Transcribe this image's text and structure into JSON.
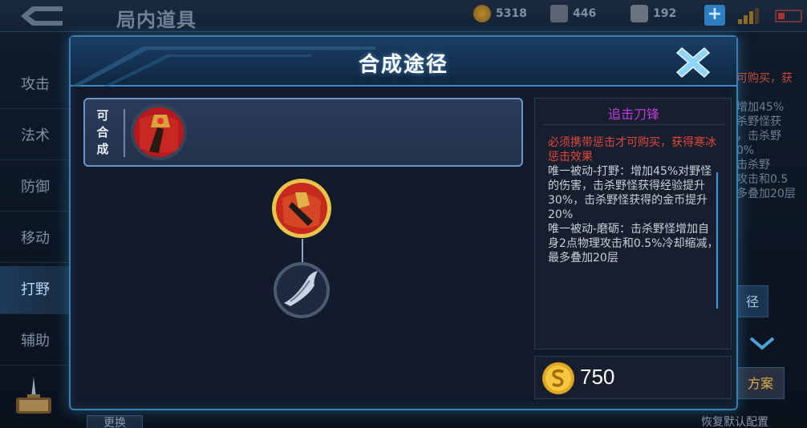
{
  "topbar": {
    "title": "局内道具",
    "gold": "5318",
    "diamond": "446",
    "voucher": "192"
  },
  "leftnav": {
    "items": [
      "攻击",
      "法术",
      "防御",
      "移动",
      "打野",
      "辅助"
    ],
    "active_index": 4
  },
  "background_right": {
    "lines": [
      "可购买，获",
      "增加45%",
      "杀野怪获",
      "，击杀野",
      "0%",
      "击杀野",
      "攻击和0.5",
      "多叠加20层"
    ],
    "path_button": "径",
    "scheme_button": "方案"
  },
  "background_bottom": {
    "left_button": "更换",
    "restore_default": "恢复默认配置"
  },
  "modal": {
    "title": "合成途径",
    "combine_label": "可合成",
    "info": {
      "name": "追击刀锋",
      "requirement": "必须携带惩击才可购买，获得寒冰惩击效果",
      "desc1": "唯一被动-打野：增加45%对野怪的伤害，击杀野怪获得经验提升30%，击杀野怪获得的金币提升20%",
      "desc2": "唯一被动-磨砺：击杀野怪增加自身2点物理攻击和0.5%冷却缩减，最多叠加20层"
    },
    "price": "750"
  },
  "colors": {
    "accent_blue": "#3a7fb1",
    "item_name_purple": "#c03bdc",
    "requirement_red": "#e0473d",
    "gold_ring": "#e7c34a"
  }
}
